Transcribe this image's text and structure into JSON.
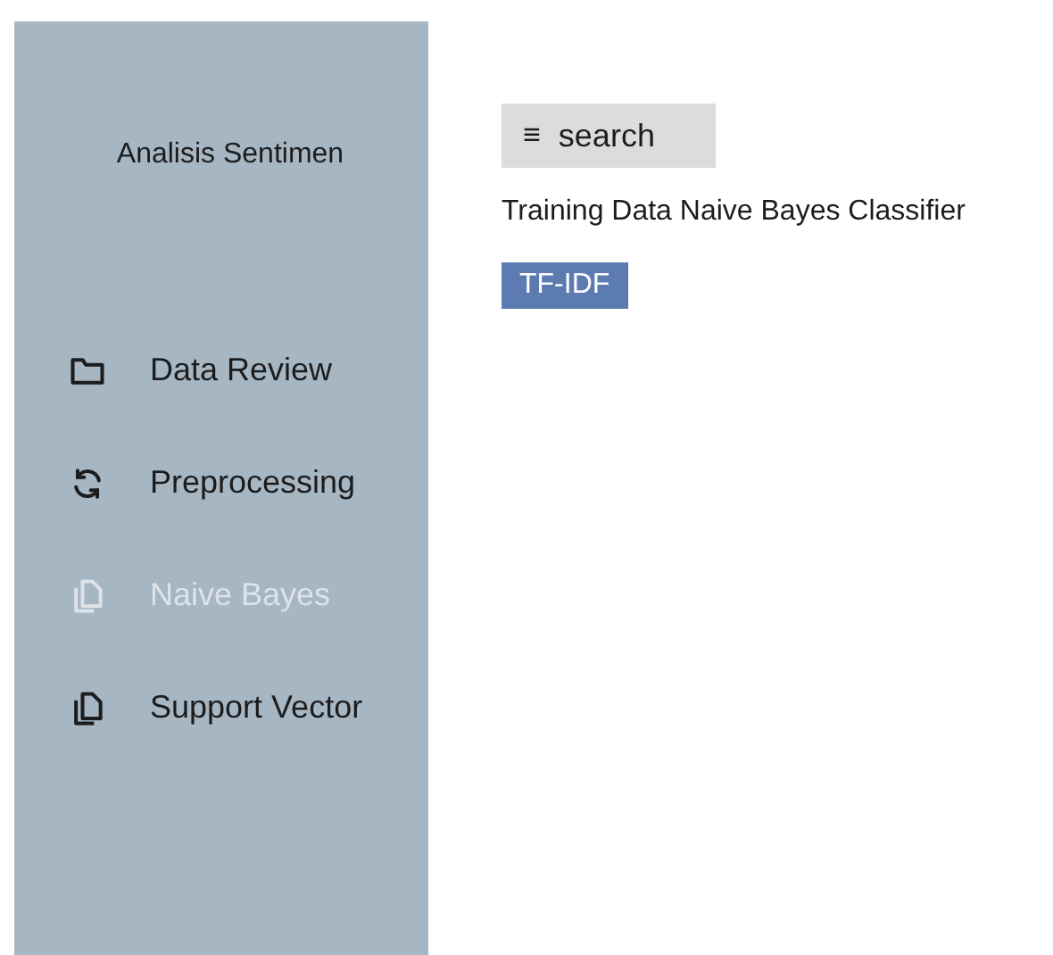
{
  "sidebar": {
    "title": "Analisis Sentimen",
    "items": [
      {
        "label": "Data Review",
        "kind": "folder",
        "selected": false
      },
      {
        "label": "Preprocessing",
        "kind": "refresh",
        "selected": false
      },
      {
        "label": "Naive Bayes",
        "kind": "copy",
        "selected": true
      },
      {
        "label": "Support Vector",
        "kind": "copy",
        "selected": false
      }
    ]
  },
  "search": {
    "icon": "≡",
    "label": "search"
  },
  "heading": "Training Data Naive Bayes Classifier",
  "tag": "TF-IDF"
}
